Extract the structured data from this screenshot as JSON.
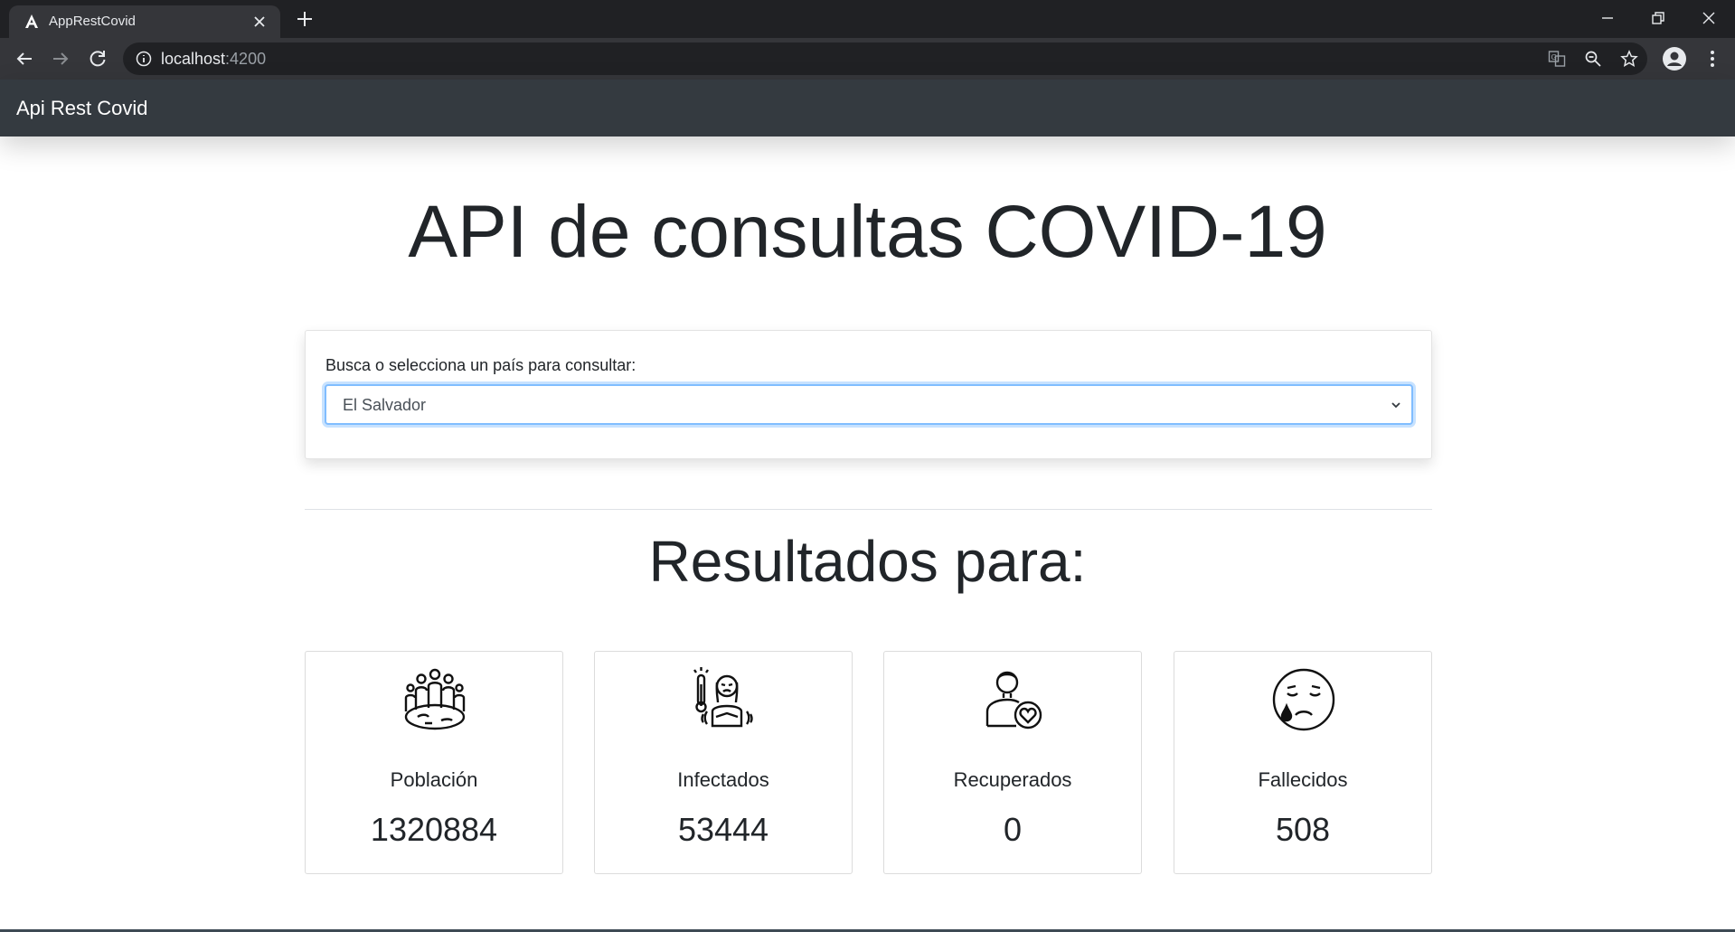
{
  "browser": {
    "tab_title": "AppRestCovid",
    "url_host": "localhost",
    "url_port": ":4200"
  },
  "app": {
    "brand": "Api Rest Covid",
    "title": "API de consultas COVID-19",
    "search": {
      "label": "Busca o selecciona un país para consultar:",
      "selected_country": "El Salvador"
    },
    "results_title": "Resultados para:",
    "stats": [
      {
        "label": "Población",
        "value": "1320884",
        "icon": "population-icon"
      },
      {
        "label": "Infectados",
        "value": "53444",
        "icon": "infected-icon"
      },
      {
        "label": "Recuperados",
        "value": "0",
        "icon": "recovered-icon"
      },
      {
        "label": "Fallecidos",
        "value": "508",
        "icon": "deceased-icon"
      }
    ]
  },
  "colors": {
    "navbar": "#343a40",
    "chrome_dark": "#202124",
    "chrome_tab": "#35363a",
    "select_focus": "#80bdff"
  }
}
